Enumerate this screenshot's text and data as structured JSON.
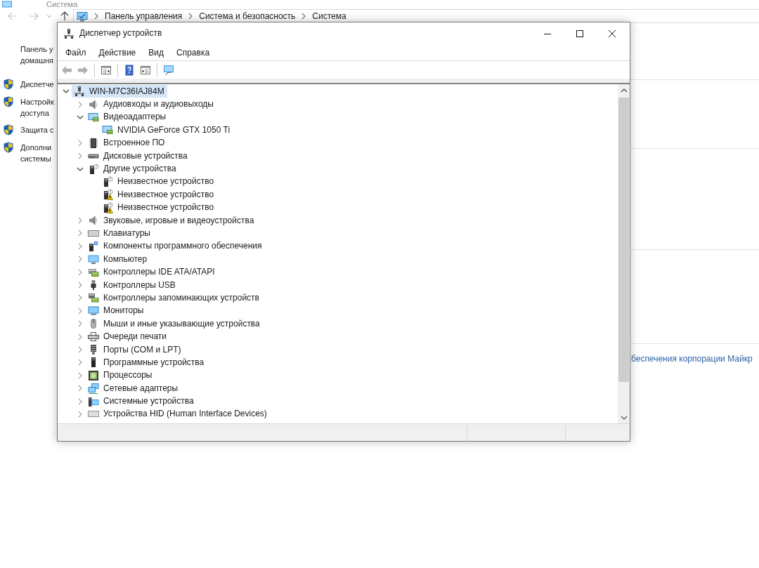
{
  "background_window": {
    "title": "Система",
    "nav": [
      {
        "kind": "back",
        "disabled": true
      },
      {
        "kind": "forward",
        "disabled": true
      },
      {
        "kind": "recent",
        "disabled": true
      },
      {
        "kind": "up",
        "disabled": false
      }
    ],
    "breadcrumbs": [
      "Панель управления",
      "Система и безопасность",
      "Система"
    ],
    "sidebar": {
      "home_link": [
        "Панель у",
        "домашня"
      ],
      "items": [
        {
          "lines": [
            "Диспетче"
          ]
        },
        {
          "lines": [
            "Настройк",
            "доступа"
          ]
        },
        {
          "lines": [
            "Защита с"
          ]
        },
        {
          "lines": [
            "Дополни",
            "системы"
          ]
        }
      ]
    },
    "link": "беспечения корпорации Майкр"
  },
  "dialog": {
    "title": "Диспетчер устройств",
    "menu": [
      "Файл",
      "Действие",
      "Вид",
      "Справка"
    ],
    "toolbar": [
      {
        "kind": "back",
        "disabled": true
      },
      {
        "kind": "forward",
        "disabled": true
      },
      {
        "kind": "separator"
      },
      {
        "kind": "pane",
        "disabled": false
      },
      {
        "kind": "separator"
      },
      {
        "kind": "help",
        "disabled": false
      },
      {
        "kind": "properties",
        "disabled": false
      },
      {
        "kind": "separator"
      },
      {
        "kind": "scan",
        "disabled": false
      }
    ],
    "tree": {
      "label": "WIN-M7C36IAJ84M",
      "kind": "host",
      "selected": true,
      "expanded": true,
      "children": [
        {
          "label": "Аудиовходы и аудиовыходы",
          "kind": "audio",
          "selected": false,
          "expanded": false
        },
        {
          "label": "Видеоадаптеры",
          "kind": "display",
          "selected": false,
          "expanded": true,
          "children": [
            {
              "label": "NVIDIA GeForce GTX 1050 Ti",
              "kind": "display",
              "selected": false
            }
          ]
        },
        {
          "label": "Встроенное ПО",
          "kind": "firmware",
          "selected": false,
          "expanded": false
        },
        {
          "label": "Дисковые устройства",
          "kind": "disk",
          "selected": false,
          "expanded": false
        },
        {
          "label": "Другие устройства",
          "kind": "unknown",
          "selected": false,
          "expanded": true,
          "children": [
            {
              "label": "Неизвестное устройство",
              "kind": "unknown",
              "selected": false,
              "warning": false
            },
            {
              "label": "Неизвестное устройство",
              "kind": "unknown",
              "selected": false,
              "warning": true
            },
            {
              "label": "Неизвестное устройство",
              "kind": "unknown",
              "selected": false,
              "warning": true
            }
          ]
        },
        {
          "label": "Звуковые, игровые и видеоустройства",
          "kind": "audio",
          "selected": false,
          "expanded": false
        },
        {
          "label": "Клавиатуры",
          "kind": "keyboard",
          "selected": false,
          "expanded": false
        },
        {
          "label": "Компоненты программного обеспечения",
          "kind": "component",
          "selected": false,
          "expanded": false
        },
        {
          "label": "Компьютер",
          "kind": "computer",
          "selected": false,
          "expanded": false
        },
        {
          "label": "Контроллеры IDE ATA/ATAPI",
          "kind": "ide",
          "selected": false,
          "expanded": false
        },
        {
          "label": "Контроллеры USB",
          "kind": "usb",
          "selected": false,
          "expanded": false
        },
        {
          "label": "Контроллеры запоминающих устройств",
          "kind": "storage",
          "selected": false,
          "expanded": false
        },
        {
          "label": "Мониторы",
          "kind": "monitor",
          "selected": false,
          "expanded": false
        },
        {
          "label": "Мыши и иные указывающие устройства",
          "kind": "mouse",
          "selected": false,
          "expanded": false
        },
        {
          "label": "Очереди печати",
          "kind": "printer",
          "selected": false,
          "expanded": false
        },
        {
          "label": "Порты (COM и LPT)",
          "kind": "port",
          "selected": false,
          "expanded": false
        },
        {
          "label": "Программные устройства",
          "kind": "softdevice",
          "selected": false,
          "expanded": false
        },
        {
          "label": "Процессоры",
          "kind": "processor",
          "selected": false,
          "expanded": false
        },
        {
          "label": "Сетевые адаптеры",
          "kind": "network",
          "selected": false,
          "expanded": false
        },
        {
          "label": "Системные устройства",
          "kind": "system",
          "selected": false,
          "expanded": false
        },
        {
          "label": "Устройства HID (Human Interface Devices)",
          "kind": "hid",
          "selected": false,
          "expanded": false
        }
      ]
    }
  }
}
